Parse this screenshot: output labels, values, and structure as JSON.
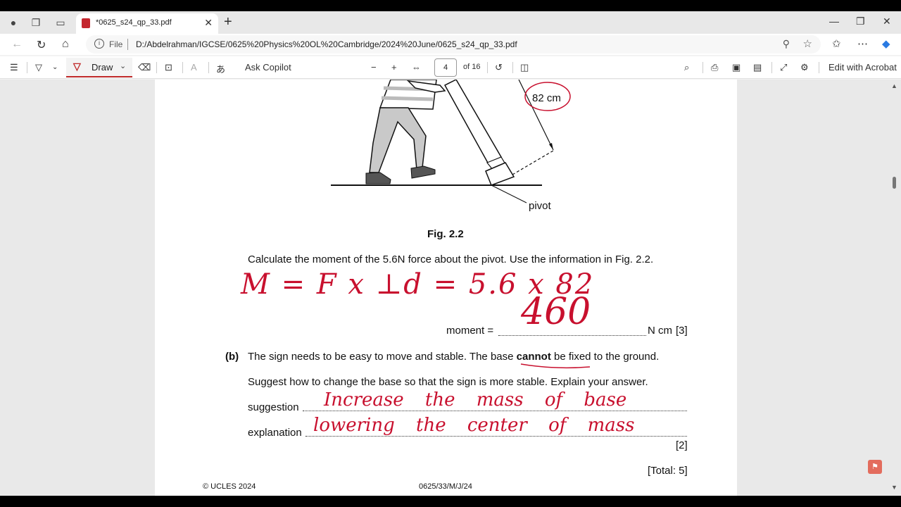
{
  "browser": {
    "tab_title": "*0625_s24_qp_33.pdf",
    "file_label": "File",
    "url": "D:/Abdelrahman/IGCSE/0625%20Physics%20OL%20Cambridge/2024%20June/0625_s24_qp_33.pdf"
  },
  "pdf_toolbar": {
    "draw_label": "Draw",
    "ask_copilot": "Ask Copilot",
    "page_current": "4",
    "page_total": "of 16",
    "edit_acrobat": "Edit with Acrobat"
  },
  "document": {
    "figure_labels": {
      "distance": "82 cm",
      "pivot": "pivot"
    },
    "figure_caption": "Fig. 2.2",
    "question_a": "Calculate the moment of the 5.6N force about the pivot. Use the information in Fig. 2.2.",
    "moment_label": "moment =",
    "moment_unit": "N cm",
    "moment_marks": "[3]",
    "part_b_label": "(b)",
    "question_b_pre": "The sign needs to be easy to move and stable. The base ",
    "question_b_bold": "cannot",
    "question_b_post": " be fixed to the ground.",
    "question_b2": "Suggest how to change the base so that the sign is more stable. Explain your answer.",
    "suggestion_label": "suggestion",
    "explanation_label": "explanation",
    "marks_b": "[2]",
    "total": "[Total: 5]",
    "footer_left": "© UCLES 2024",
    "footer_mid": "0625/33/M/J/24"
  },
  "handwriting": {
    "working": "M = F x ⊥d = 5.6 x 82",
    "answer": "460",
    "suggestion": "Increase the mass of base",
    "explanation": "lowering the center of mass"
  },
  "colors": {
    "ink": "#c8102e",
    "draw_accent": "#c02a2a"
  }
}
